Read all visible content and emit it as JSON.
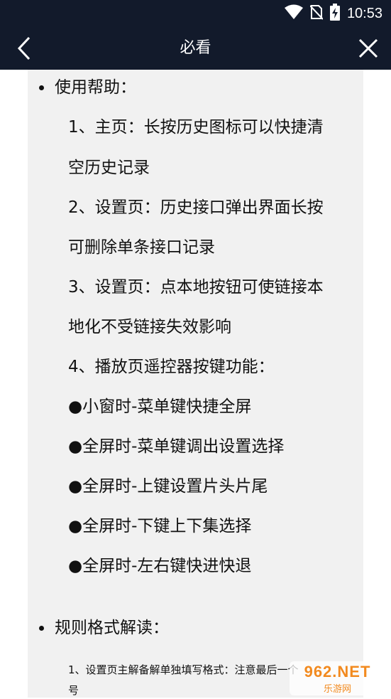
{
  "status_bar": {
    "time": "10:53",
    "icons": [
      "wifi-icon",
      "no-sim-icon",
      "battery-charging-icon"
    ]
  },
  "app_bar": {
    "title": "必看",
    "back_icon": "back-chevron-icon",
    "close_icon": "close-icon"
  },
  "content": {
    "section1": {
      "heading": "使用帮助：",
      "lines": [
        "1、主页：长按历史图标可以快捷清",
        "空历史记录",
        "2、设置页：历史接口弹出界面长按",
        "可删除单条接口记录",
        "3、设置页：点本地按钮可使链接本",
        "地化不受链接失效影响",
        "4、播放页遥控器按键功能：",
        "●小窗时-菜单键快捷全屏",
        "●全屏时-菜单键调出设置选择",
        "●全屏时-上键设置片头片尾",
        "●全屏时-下键上下集选择",
        "●全屏时-左右键快进快退"
      ]
    },
    "section2": {
      "heading": "规则格式解读：",
      "lines": [
        "1、设置页主解备解单独填写格式：注意最后一个",
        "号"
      ]
    }
  },
  "watermark": {
    "top": "962.NET",
    "bottom": "乐游网"
  }
}
